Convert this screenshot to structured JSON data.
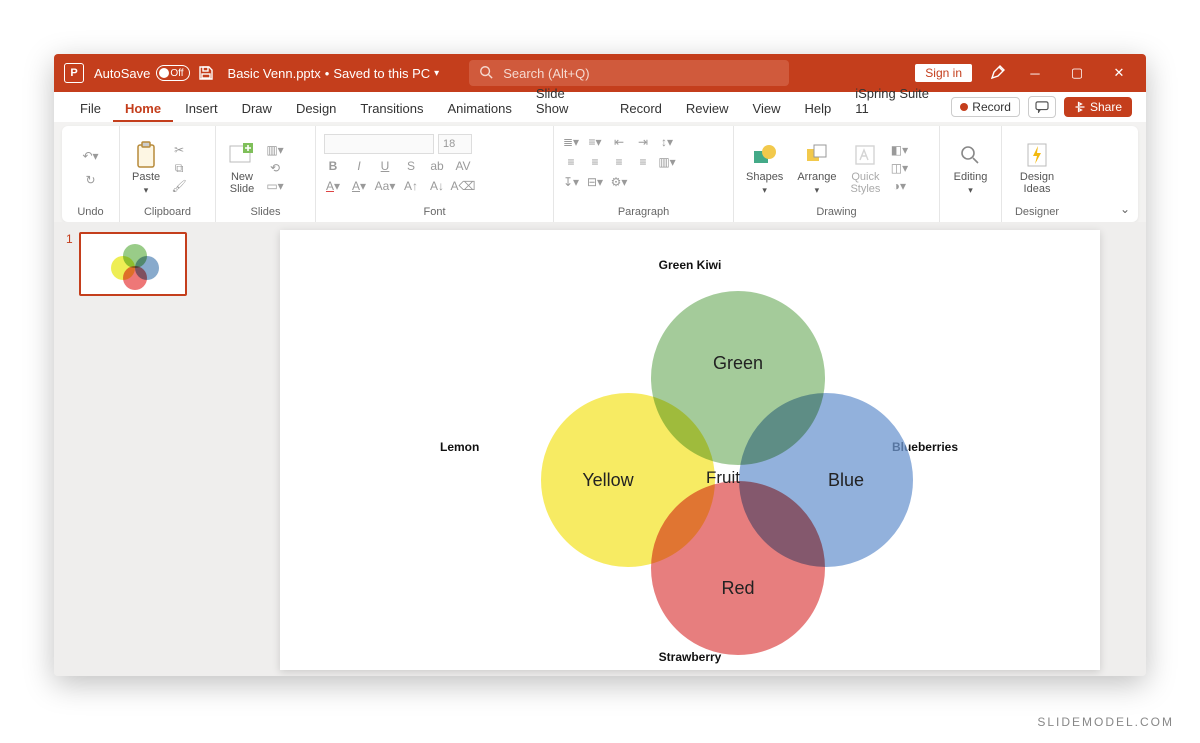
{
  "titlebar": {
    "autosave_label": "AutoSave",
    "autosave_state": "Off",
    "filename": "Basic Venn.pptx",
    "save_status": "Saved to this PC",
    "search_placeholder": "Search (Alt+Q)",
    "signin": "Sign in"
  },
  "tabs": {
    "file": "File",
    "home": "Home",
    "insert": "Insert",
    "draw": "Draw",
    "design": "Design",
    "transitions": "Transitions",
    "animations": "Animations",
    "slideshow": "Slide Show",
    "record": "Record",
    "review": "Review",
    "view": "View",
    "help": "Help",
    "ispring": "iSpring Suite 11",
    "record_btn": "Record",
    "share": "Share"
  },
  "ribbon": {
    "undo": "Undo",
    "clipboard": {
      "name": "Clipboard",
      "paste": "Paste"
    },
    "slides": {
      "name": "Slides",
      "new": "New\nSlide"
    },
    "font": {
      "name": "Font",
      "size": "18"
    },
    "paragraph": {
      "name": "Paragraph"
    },
    "drawing": {
      "name": "Drawing",
      "shapes": "Shapes",
      "arrange": "Arrange",
      "quick": "Quick\nStyles"
    },
    "editing": {
      "name": "",
      "editing": "Editing"
    },
    "designer": {
      "name": "Designer",
      "ideas": "Design\nIdeas"
    }
  },
  "thumbs": {
    "n1": "1"
  },
  "venn": {
    "green": "Green",
    "yellow": "Yellow",
    "blue": "Blue",
    "red": "Red",
    "center": "Fruit",
    "l_top": "Green Kiwi",
    "l_left": "Lemon",
    "l_right": "Blueberries",
    "l_bottom": "Strawberry"
  },
  "watermark": "SLIDEMODEL.COM"
}
